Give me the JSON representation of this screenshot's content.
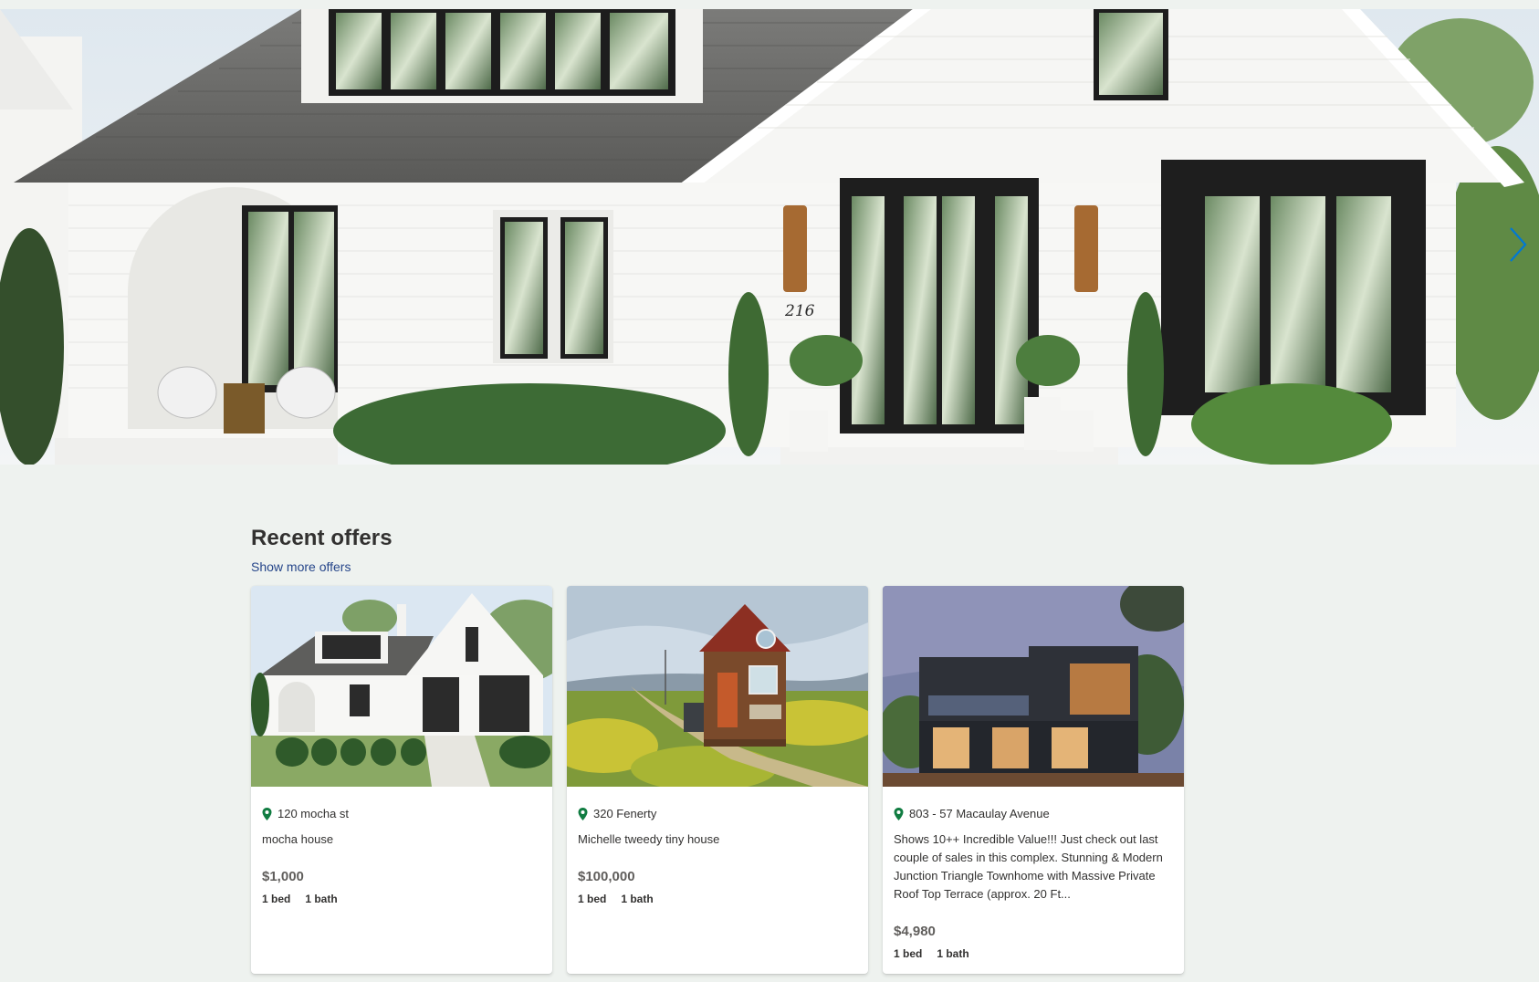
{
  "hero": {
    "house_number": "216",
    "icons": {
      "next": "chevron-right-icon",
      "prev": "chevron-left-icon"
    }
  },
  "offers": {
    "title": "Recent offers",
    "show_more": "Show more offers",
    "cards": [
      {
        "address": "120 mocha st",
        "description": "mocha house",
        "price": "$1,000",
        "beds": "1 bed",
        "baths": "1 bath"
      },
      {
        "address": "320 Fenerty",
        "description": "Michelle tweedy tiny house",
        "price": "$100,000",
        "beds": "1 bed",
        "baths": "1 bath"
      },
      {
        "address": "803 - 57 Macaulay Avenue",
        "description": "Shows 10++ Incredible Value!!! Just check out last couple of sales in this complex. Stunning & Modern Junction Triangle Townhome with Massive Private Roof Top Terrace (approx. 20 Ft...",
        "price": "$4,980",
        "beds": "1 bed",
        "baths": "1 bath"
      }
    ]
  },
  "colors": {
    "page_background": "#eef2ef",
    "link": "#26468a",
    "pin": "#107c41",
    "chevron": "#0078d4"
  }
}
